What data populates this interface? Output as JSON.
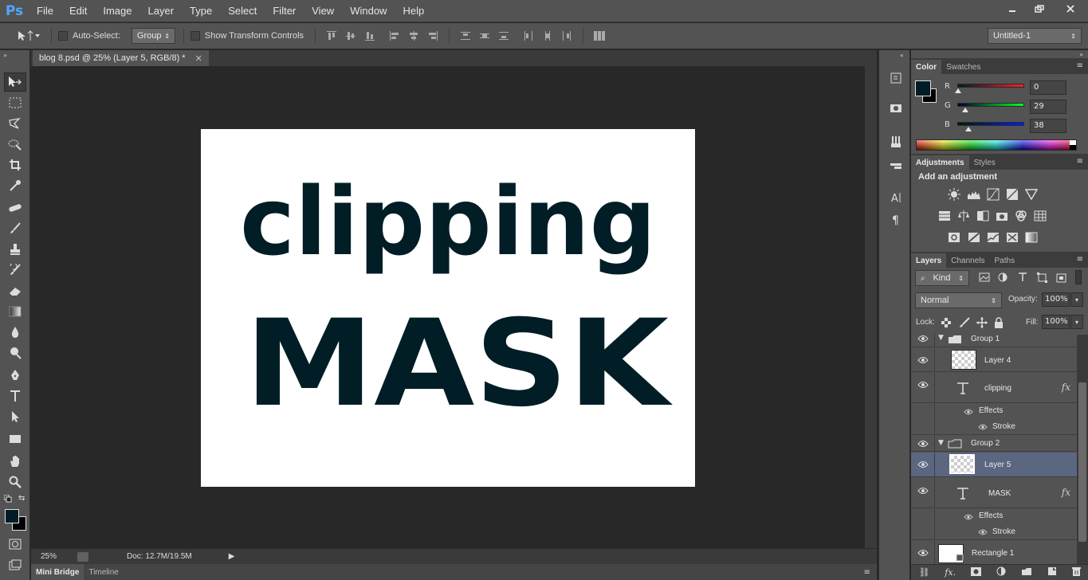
{
  "app": {
    "logo_text": "Ps",
    "menu": [
      "File",
      "Edit",
      "Image",
      "Layer",
      "Type",
      "Select",
      "Filter",
      "View",
      "Window",
      "Help"
    ],
    "window_controls": [
      "minimize",
      "restore",
      "close"
    ]
  },
  "options_bar": {
    "auto_select_label": "Auto-Select:",
    "auto_select_value": "Group",
    "show_transform_label": "Show Transform Controls",
    "workspace_value": "Untitled-1"
  },
  "document": {
    "tab_title": "blog 8.psd @ 25% (Layer 5, RGB/8) *",
    "canvas_text_top": "clipping",
    "canvas_text_bottom": "MASK",
    "text_color": "#011d26"
  },
  "status": {
    "zoom": "25%",
    "doc_info": "Doc: 12.7M/19.5M"
  },
  "bottom_tabs": [
    "Mini Bridge",
    "Timeline"
  ],
  "color_panel": {
    "tabs": [
      "Color",
      "Swatches"
    ],
    "foreground": "#001d26",
    "background": "#000000",
    "r_label": "R",
    "r_value": "0",
    "g_label": "G",
    "g_value": "29",
    "b_label": "B",
    "b_value": "38"
  },
  "adjustments_panel": {
    "tabs": [
      "Adjustments",
      "Styles"
    ],
    "heading": "Add an adjustment"
  },
  "layers_panel": {
    "tabs": [
      "Layers",
      "Channels",
      "Paths"
    ],
    "filter_kind": "Kind",
    "blend_mode": "Normal",
    "opacity_label": "Opacity:",
    "opacity_value": "100%",
    "lock_label": "Lock:",
    "fill_label": "Fill:",
    "fill_value": "100%",
    "layers": [
      {
        "name": "Group 1",
        "kind": "group"
      },
      {
        "name": "Layer 4",
        "kind": "pixel"
      },
      {
        "name": "clipping",
        "kind": "text",
        "fx": "fx"
      },
      {
        "name": "Effects",
        "kind": "effects"
      },
      {
        "name": "Stroke",
        "kind": "effect"
      },
      {
        "name": "Group 2",
        "kind": "group"
      },
      {
        "name": "Layer 5",
        "kind": "pixel",
        "selected": true
      },
      {
        "name": "MASK",
        "kind": "text",
        "fx": "fx"
      },
      {
        "name": "Effects",
        "kind": "effects"
      },
      {
        "name": "Stroke",
        "kind": "effect"
      },
      {
        "name": "Rectangle 1",
        "kind": "shape"
      }
    ]
  }
}
